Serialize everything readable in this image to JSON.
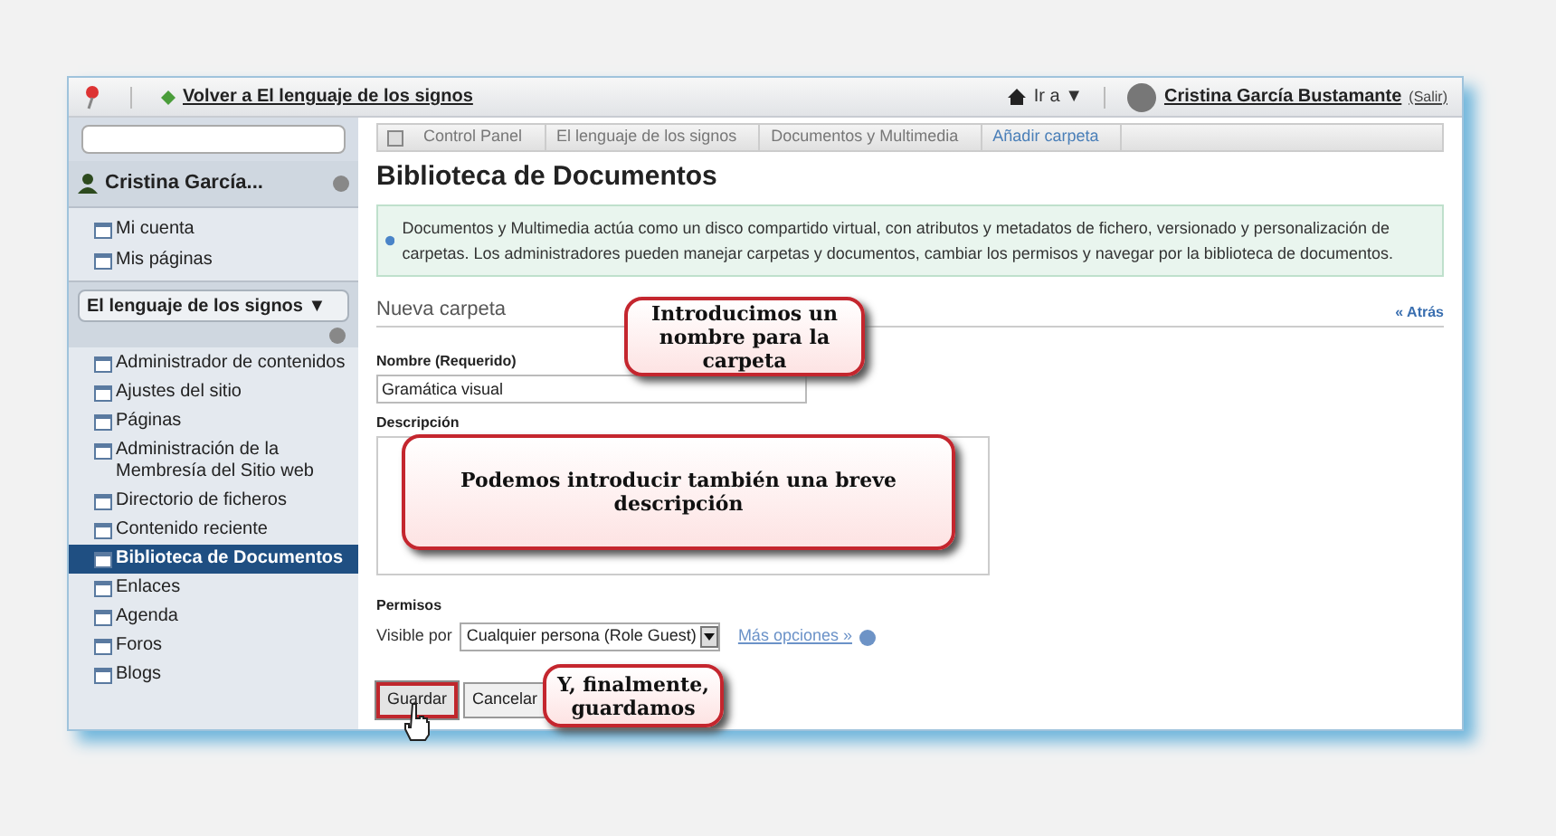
{
  "top_bar": {
    "back_link": "Volver a El lenguaje de los signos",
    "go_to": "Ir a ▼",
    "user_name": "Cristina García Bustamante",
    "sign_out": "(Salir)"
  },
  "sidebar": {
    "user_name": "Cristina García...",
    "user_items": [
      "Mi cuenta",
      "Mis páginas"
    ],
    "site_selector": "El lenguaje de los signos ▼",
    "site_items": [
      {
        "label": "Administrador de contenidos",
        "selected": false
      },
      {
        "label": "Ajustes del sitio",
        "selected": false
      },
      {
        "label": "Páginas",
        "selected": false
      },
      {
        "label": "Administración de la Membresía del Sitio web",
        "selected": false
      },
      {
        "label": "Directorio de ficheros",
        "selected": false
      },
      {
        "label": "Contenido reciente",
        "selected": false
      },
      {
        "label": "Biblioteca de Documentos",
        "selected": true
      },
      {
        "label": "Enlaces",
        "selected": false
      },
      {
        "label": "Agenda",
        "selected": false
      },
      {
        "label": "Foros",
        "selected": false
      },
      {
        "label": "Blogs",
        "selected": false
      }
    ]
  },
  "breadcrumb": [
    {
      "label": "Control Panel",
      "selected": false
    },
    {
      "label": "El lenguaje de los signos",
      "selected": false
    },
    {
      "label": "Documentos y Multimedia",
      "selected": false
    },
    {
      "label": "Añadir carpeta",
      "selected": true
    }
  ],
  "page_title": "Biblioteca de Documentos",
  "info_text": "Documentos y Multimedia actúa como un disco compartido virtual, con atributos y metadatos de fichero, versionado y personalización de carpetas. Los administradores pueden manejar carpetas y documentos, cambiar los permisos y navegar por la biblioteca de documentos.",
  "form": {
    "section_title": "Nueva carpeta",
    "back_link": "« Atrás",
    "name_label": "Nombre (Requerido)",
    "name_value": "Gramática visual",
    "description_label": "Descripción",
    "permissions_label": "Permisos",
    "visible_by_label": "Visible por",
    "visible_by_value": "Cualquier persona (Role Guest)",
    "more_options": "Más opciones »",
    "buttons": [
      "Guardar",
      "Cancelar"
    ]
  },
  "callouts": [
    "Introducimos un nombre para la carpeta",
    "Podemos introducir también una breve descripción",
    "Y, finalmente, guardamos"
  ]
}
